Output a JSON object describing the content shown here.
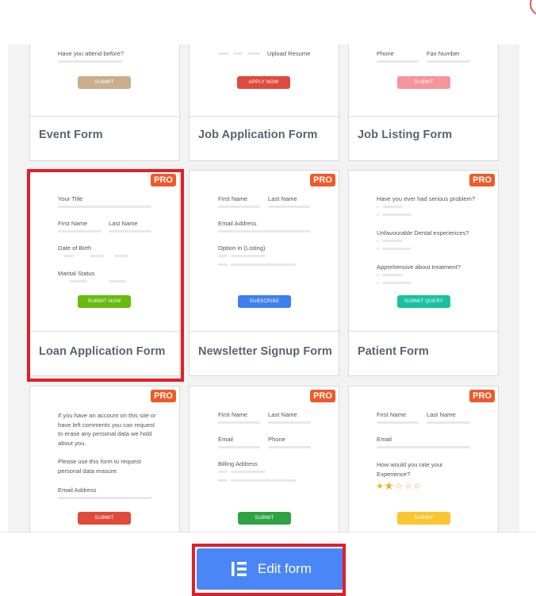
{
  "badge_label": "PRO",
  "cards": {
    "event": {
      "title": "Event Form",
      "question": "Have you attend before?",
      "button": "SUBMIT",
      "button_color": "#c9ad8d"
    },
    "job_application": {
      "title": "Job Application Form",
      "upload_label": "Upload Resume",
      "button": "APPLY NOW",
      "button_color": "#e04a3a"
    },
    "job_listing": {
      "title": "Job Listing Form",
      "phone_label": "Phone",
      "fax_label": "Fax Number",
      "button": "SUBMIT",
      "button_color": "#f7949b"
    },
    "loan": {
      "title": "Loan Application Form",
      "your_title": "Your Title",
      "first_name": "First Name",
      "last_name": "Last Name",
      "dob": "Date of Birth",
      "marital": "Marital Status",
      "button": "SUBMIT NOW",
      "button_color": "#66bb0e"
    },
    "newsletter": {
      "title": "Newsletter Signup Form",
      "first_name": "First Name",
      "last_name": "Last Name",
      "email": "Email Address",
      "option": "Option in (Listing)",
      "button": "SUBSCRIBE",
      "button_color": "#3d7ff0"
    },
    "patient": {
      "title": "Patient Form",
      "q1": "Have you ever had serious problem?",
      "q2": "Unfavourable Dental experiences?",
      "q3": "Apprehensive about treatment?",
      "button": "SUBMIT QUERY",
      "button_color": "#18c2a1"
    },
    "gdpr": {
      "para1": "If you have an account on this site or have left comments you can request to erase any personal data we hold about you.",
      "para2": "Please use this form to request personal data erasure.",
      "email": "Email Address",
      "button": "SUBMIT",
      "button_color": "#e04a3a"
    },
    "billing": {
      "first_name": "First Name",
      "last_name": "Last Name",
      "email": "Email",
      "phone": "Phone",
      "billing_address": "Billing Address",
      "button": "SUBMIT",
      "button_color": "#2fa344"
    },
    "rating": {
      "first_name": "First Name",
      "last_name": "Last Name",
      "email": "Email",
      "question": "How would you rate your Experience?",
      "rating_value": 1.5,
      "rating_max": 5,
      "button": "SUBMIT",
      "button_color": "#f9c630"
    }
  },
  "edit_button": {
    "label": "Edit form",
    "icon": "elementor-icon"
  },
  "colors": {
    "highlight": "#e21f26",
    "badge": "#f05a28",
    "primary": "#4a86f5"
  }
}
